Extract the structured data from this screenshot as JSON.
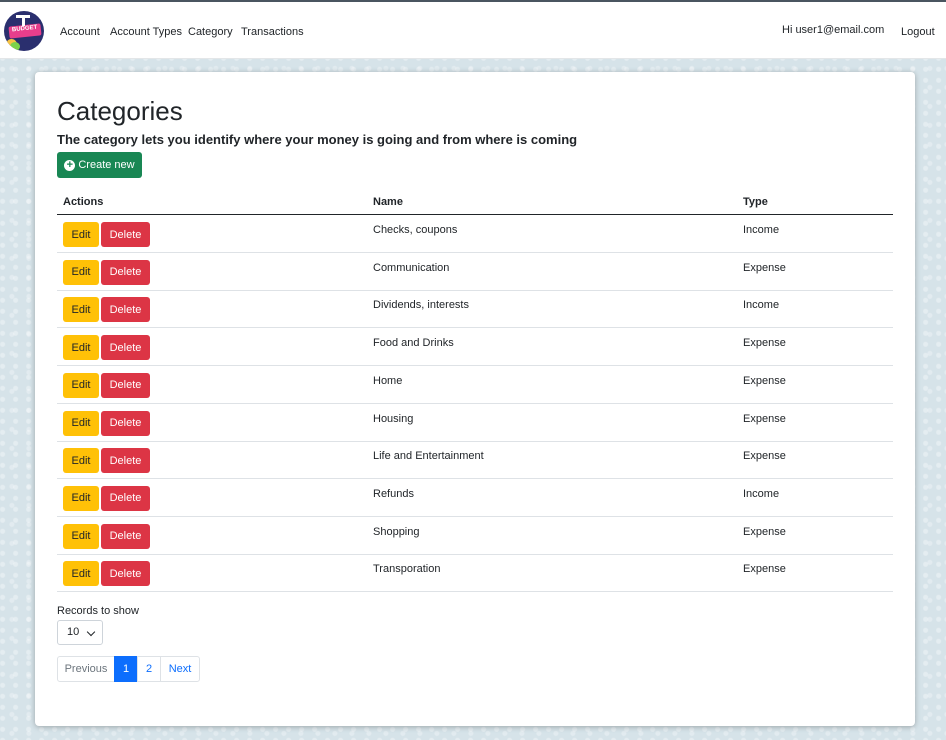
{
  "navbar": {
    "logo_text": "BUDGET",
    "links": [
      "Account",
      "Account Types",
      "Category",
      "Transactions"
    ],
    "greeting": "Hi user1@email.com",
    "logout": "Logout"
  },
  "page": {
    "title": "Categories",
    "subtitle": "The category lets you identify where your money is going and from where is coming",
    "create_label": "Create new"
  },
  "table": {
    "headers": {
      "actions": "Actions",
      "name": "Name",
      "type": "Type"
    },
    "edit_label": "Edit",
    "delete_label": "Delete",
    "rows": [
      {
        "name": "Checks, coupons",
        "type": "Income"
      },
      {
        "name": "Communication",
        "type": "Expense"
      },
      {
        "name": "Dividends, interests",
        "type": "Income"
      },
      {
        "name": "Food and Drinks",
        "type": "Expense"
      },
      {
        "name": "Home",
        "type": "Expense"
      },
      {
        "name": "Housing",
        "type": "Expense"
      },
      {
        "name": "Life and Entertainment",
        "type": "Expense"
      },
      {
        "name": "Refunds",
        "type": "Income"
      },
      {
        "name": "Shopping",
        "type": "Expense"
      },
      {
        "name": "Transporation",
        "type": "Expense"
      }
    ]
  },
  "records": {
    "label": "Records to show",
    "value": "10"
  },
  "pagination": {
    "previous": "Previous",
    "pages": [
      "1",
      "2"
    ],
    "active_page": "1",
    "next": "Next"
  },
  "colors": {
    "create": "#198754",
    "edit": "#ffc107",
    "delete": "#dc3545",
    "active_page": "#0d6efd"
  }
}
